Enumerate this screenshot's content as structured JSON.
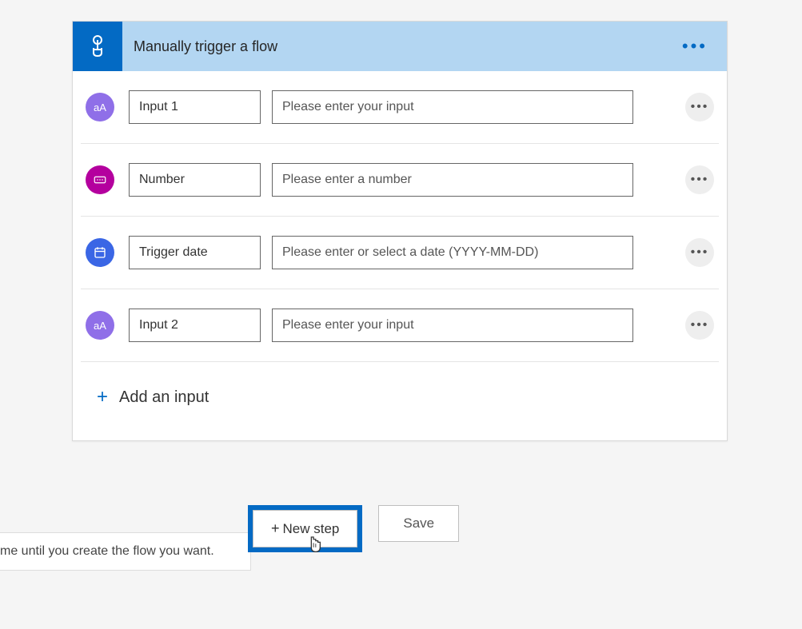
{
  "header": {
    "title": "Manually trigger a flow"
  },
  "inputs": [
    {
      "type": "text",
      "icon_label": "aA",
      "name": "Input 1",
      "placeholder": "Please enter your input"
    },
    {
      "type": "number",
      "icon_label": "123",
      "name": "Number",
      "placeholder": "Please enter a number"
    },
    {
      "type": "date",
      "icon_label": "cal",
      "name": "Trigger date",
      "placeholder": "Please enter or select a date (YYYY-MM-DD)"
    },
    {
      "type": "text",
      "icon_label": "aA",
      "name": "Input 2",
      "placeholder": "Please enter your input"
    }
  ],
  "add_input_label": "Add an input",
  "buttons": {
    "new_step": "New step",
    "save": "Save"
  },
  "hint_text": "me until you create the flow you want."
}
